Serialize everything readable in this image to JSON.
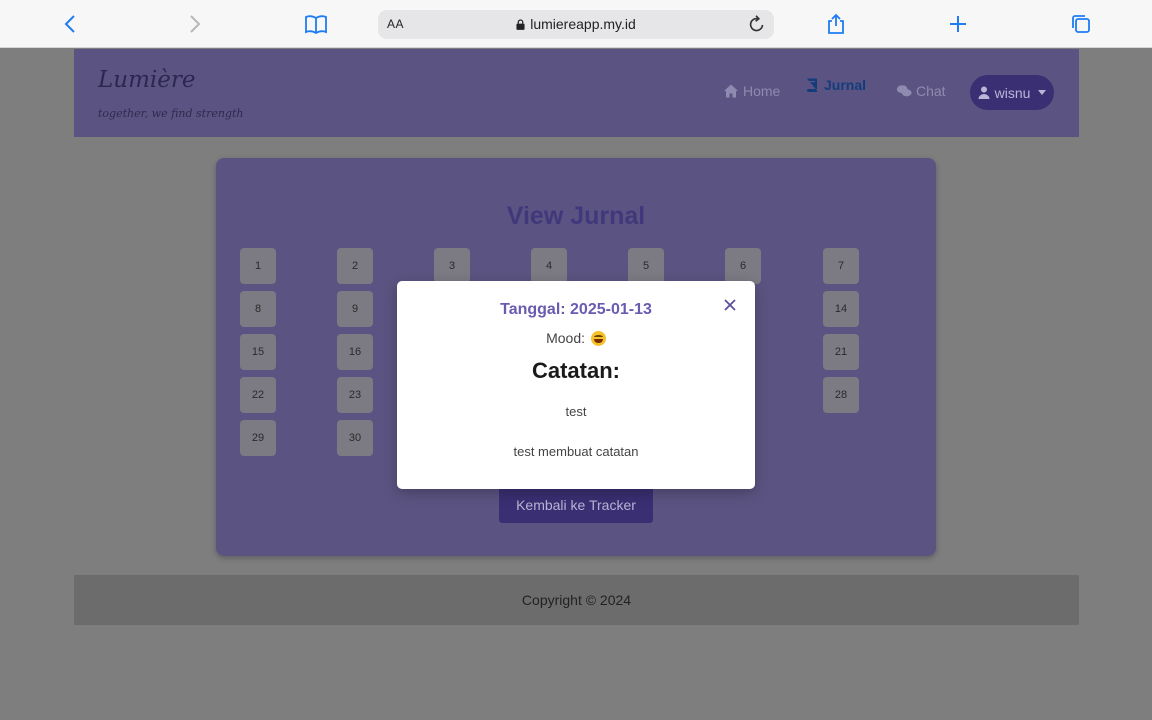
{
  "browser": {
    "aa_label": "AA",
    "url": "lumiereapp.my.id"
  },
  "navbar": {
    "brand": "Lumière",
    "tagline": "together, we find strength",
    "items": [
      {
        "label": "Home",
        "icon": "home-icon",
        "active": false
      },
      {
        "label": "Jurnal",
        "icon": "book-icon",
        "active": true
      },
      {
        "label": "Chat",
        "icon": "chat-icon",
        "active": false
      }
    ],
    "user": "wisnu"
  },
  "journal": {
    "title": "View Jurnal",
    "days": [
      "1",
      "2",
      "3",
      "4",
      "5",
      "6",
      "7",
      "8",
      "9",
      "14",
      "15",
      "16",
      "21",
      "22",
      "23",
      "28",
      "29",
      "30"
    ],
    "back_button": "Kembali ke Tracker"
  },
  "footer": {
    "copyright": "Copyright © 2024"
  },
  "modal": {
    "date_label": "Tanggal: 2025-01-13",
    "mood_label": "Mood:",
    "mood_icon": "grinning-face-emoji",
    "heading": "Catatan:",
    "line1": "test",
    "line2": "test membuat catatan",
    "close_symbol": "×"
  },
  "colors": {
    "nav_bg": "#5b5482",
    "accent": "#6a5bb1",
    "button_bg": "#3a2f72",
    "overlay": "#7e7e7e",
    "browser_blue": "#1f7cf3"
  }
}
